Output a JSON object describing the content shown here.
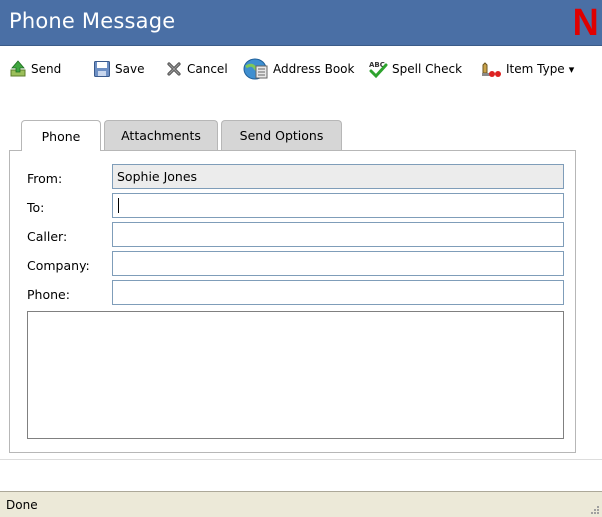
{
  "window": {
    "title": "Phone Message",
    "logo_letter": "N",
    "title_bar_color": "#4a6fa5",
    "logo_color": "#e00000"
  },
  "toolbar": {
    "send": {
      "label": "Send",
      "icon": "send-icon"
    },
    "save": {
      "label": "Save",
      "icon": "save-icon"
    },
    "cancel": {
      "label": "Cancel",
      "icon": "cancel-icon"
    },
    "address_book": {
      "label": "Address Book",
      "icon": "address-book-icon"
    },
    "spell_check": {
      "label": "Spell Check",
      "icon": "spell-check-icon"
    },
    "item_type": {
      "label": "Item Type",
      "icon": "item-type-icon",
      "dropdown_arrow": "▾"
    }
  },
  "tabs": [
    {
      "label": "Phone",
      "active": true
    },
    {
      "label": "Attachments",
      "active": false
    },
    {
      "label": "Send Options",
      "active": false
    }
  ],
  "form": {
    "from": {
      "label": "From:",
      "value": "Sophie Jones"
    },
    "to": {
      "label": "To:",
      "value": ""
    },
    "caller": {
      "label": "Caller:",
      "value": ""
    },
    "company": {
      "label": "Company:",
      "value": ""
    },
    "phone": {
      "label": "Phone:",
      "value": ""
    },
    "message": {
      "value": ""
    }
  },
  "status": {
    "text": "Done"
  }
}
